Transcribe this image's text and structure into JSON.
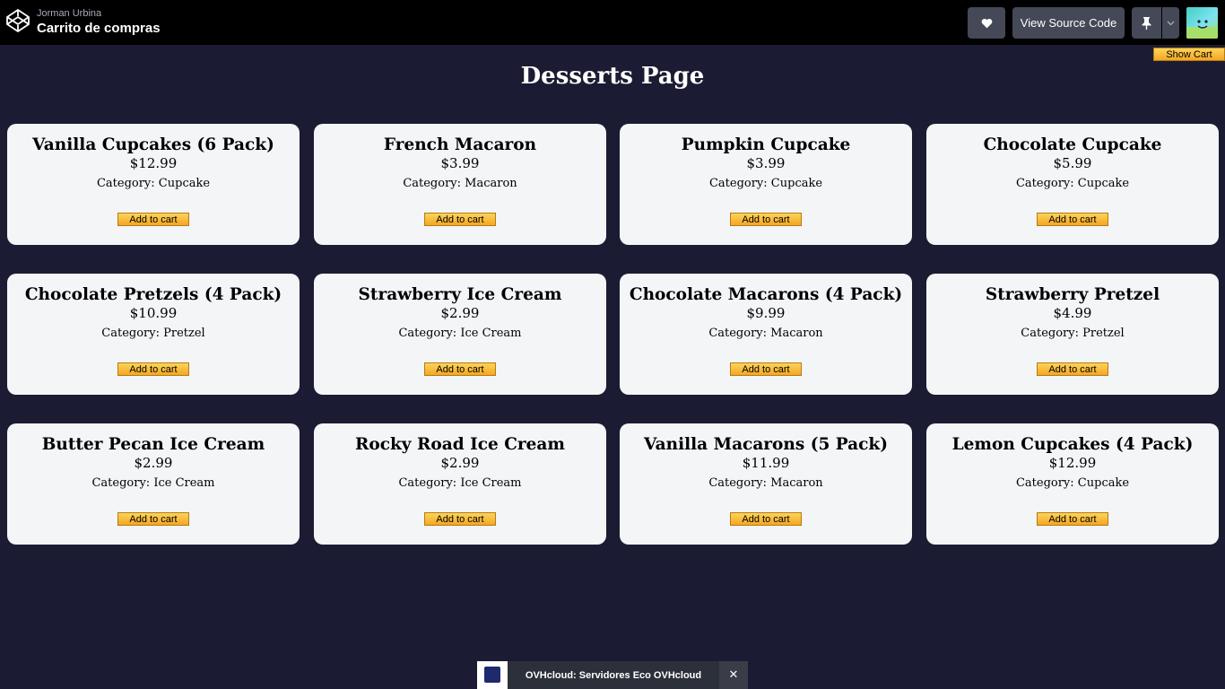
{
  "header": {
    "owner": "Jorman Urbina",
    "title": "Carrito de compras",
    "view_source_label": "View Source Code",
    "icons": {
      "logo": "codepen-icon",
      "like": "heart-icon",
      "pin": "pin-icon",
      "caret": "chevron-down-icon"
    }
  },
  "cart": {
    "show_cart_label": "Show Cart"
  },
  "page": {
    "title": "Desserts Page"
  },
  "labels": {
    "category_prefix": "Category: ",
    "add_to_cart": "Add to cart"
  },
  "products": [
    {
      "name": "Vanilla Cupcakes (6 Pack)",
      "price": "$12.99",
      "category": "Cupcake"
    },
    {
      "name": "French Macaron",
      "price": "$3.99",
      "category": "Macaron"
    },
    {
      "name": "Pumpkin Cupcake",
      "price": "$3.99",
      "category": "Cupcake"
    },
    {
      "name": "Chocolate Cupcake",
      "price": "$5.99",
      "category": "Cupcake"
    },
    {
      "name": "Chocolate Pretzels (4 Pack)",
      "price": "$10.99",
      "category": "Pretzel"
    },
    {
      "name": "Strawberry Ice Cream",
      "price": "$2.99",
      "category": "Ice Cream"
    },
    {
      "name": "Chocolate Macarons (4 Pack)",
      "price": "$9.99",
      "category": "Macaron"
    },
    {
      "name": "Strawberry Pretzel",
      "price": "$4.99",
      "category": "Pretzel"
    },
    {
      "name": "Butter Pecan Ice Cream",
      "price": "$2.99",
      "category": "Ice Cream"
    },
    {
      "name": "Rocky Road Ice Cream",
      "price": "$2.99",
      "category": "Ice Cream"
    },
    {
      "name": "Vanilla Macarons (5 Pack)",
      "price": "$11.99",
      "category": "Macaron"
    },
    {
      "name": "Lemon Cupcakes (4 Pack)",
      "price": "$12.99",
      "category": "Cupcake"
    }
  ],
  "ad": {
    "text": "OVHcloud: Servidores Eco OVHcloud",
    "close_icon": "close-icon"
  },
  "colors": {
    "background": "#1b1c33",
    "card": "#f4f5f7",
    "button_top": "#fcd45a",
    "button_bottom": "#f5a623",
    "topbar": "#000000",
    "topbar_button": "#444857"
  }
}
